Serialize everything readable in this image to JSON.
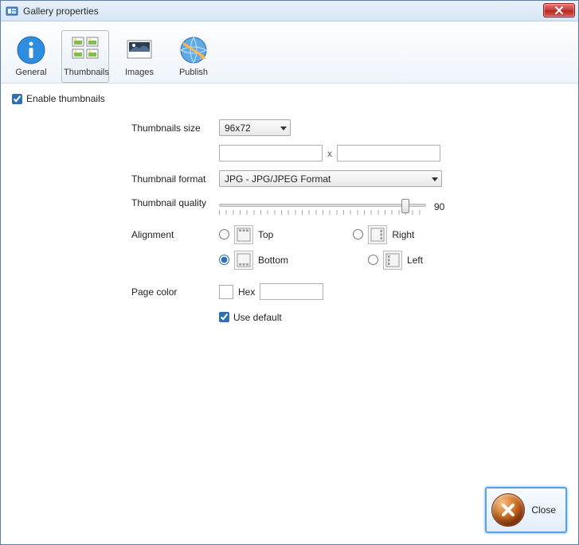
{
  "window": {
    "title": "Gallery properties"
  },
  "tabs": {
    "general": "General",
    "thumbnails": "Thumbnails",
    "images": "Images",
    "publish": "Publish",
    "selected": "thumbnails"
  },
  "form": {
    "enable_thumbnails": {
      "label": "Enable thumbnails",
      "checked": true
    },
    "thumbnails_size": {
      "label": "Thumbnails size",
      "value": "96x72"
    },
    "custom_size": {
      "width": "",
      "height": "",
      "separator": "x"
    },
    "thumbnail_format": {
      "label": "Thumbnail format",
      "value": "JPG - JPG/JPEG Format"
    },
    "thumbnail_quality": {
      "label": "Thumbnail quality",
      "value": 90,
      "min": 0,
      "max": 100
    },
    "alignment": {
      "label": "Alignment",
      "options": {
        "top": "Top",
        "right": "Right",
        "bottom": "Bottom",
        "left": "Left"
      },
      "selected": "bottom"
    },
    "page_color": {
      "label": "Page color",
      "hex_label": "Hex",
      "hex_value": "",
      "use_default_label": "Use default",
      "use_default_checked": true
    }
  },
  "footer": {
    "close": "Close"
  }
}
